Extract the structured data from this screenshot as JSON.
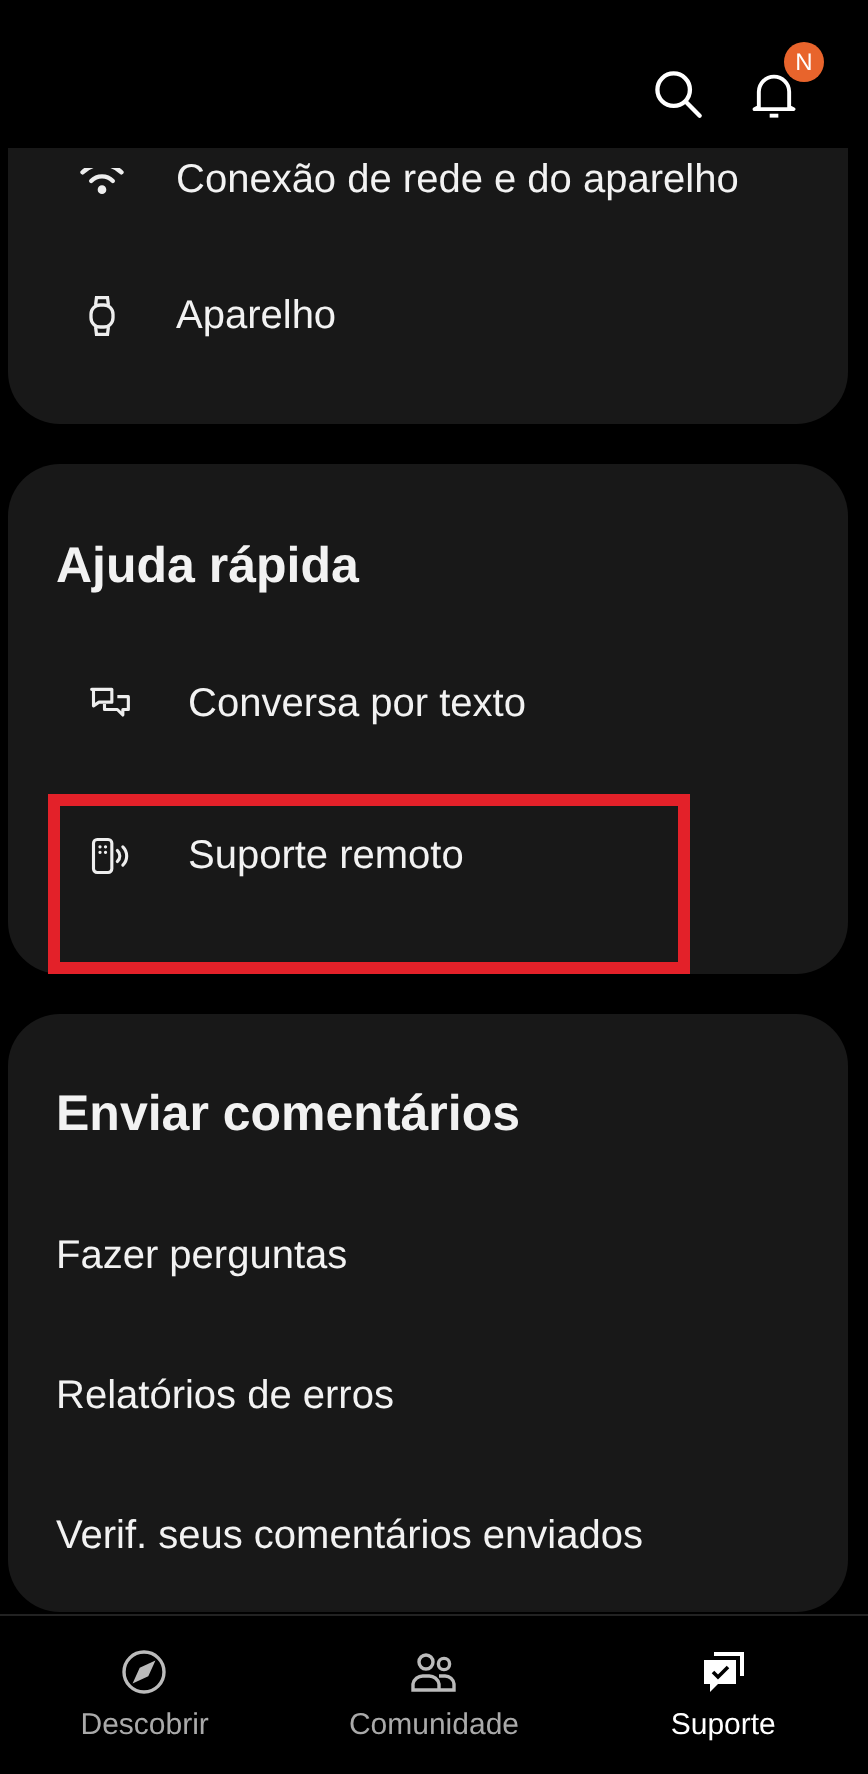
{
  "header": {
    "notification_badge": "N"
  },
  "device_card": {
    "items": [
      {
        "label": "Conexão de rede e do aparelho",
        "kind": "wifi"
      },
      {
        "label": "Aparelho",
        "kind": "watch"
      }
    ]
  },
  "quick_help": {
    "title": "Ajuda rápida",
    "items": [
      {
        "label": "Conversa por texto",
        "kind": "chat",
        "highlighted": false
      },
      {
        "label": "Suporte remoto",
        "kind": "remote",
        "highlighted": true
      }
    ]
  },
  "feedback": {
    "title": "Enviar comentários",
    "items": [
      "Fazer perguntas",
      "Relatórios de erros",
      "Verif. seus comentários enviados"
    ]
  },
  "bottom_nav": [
    {
      "label": "Descobrir",
      "kind": "compass",
      "selected": false
    },
    {
      "label": "Comunidade",
      "kind": "people",
      "selected": false
    },
    {
      "label": "Suporte",
      "kind": "support",
      "selected": true
    }
  ]
}
